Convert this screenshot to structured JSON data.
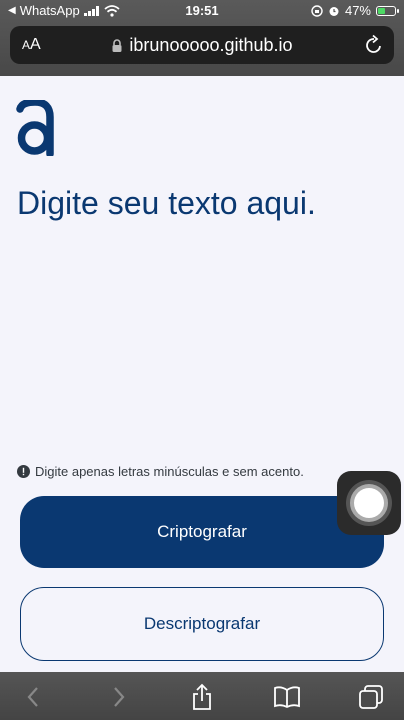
{
  "status_bar": {
    "back_app": "WhatsApp",
    "time": "19:51",
    "battery": "47%",
    "battery_level": 0.47
  },
  "browser": {
    "aa_label": "AA",
    "url": "ibrunooooo.github.io"
  },
  "main": {
    "textarea_placeholder": "Digite seu texto aqui.",
    "warning_text": "Digite apenas letras minúsculas e sem acento.",
    "encrypt_label": "Criptografar",
    "decrypt_label": "Descriptografar"
  },
  "colors": {
    "brand": "#0a3871",
    "background": "#f4f4fb"
  },
  "icons": {
    "logo": "alura-logo",
    "lock": "lock-icon",
    "reload": "reload-icon",
    "back": "chevron-left-icon",
    "forward": "chevron-right-icon",
    "share": "share-icon",
    "bookmarks": "book-icon",
    "tabs": "tabs-icon"
  }
}
